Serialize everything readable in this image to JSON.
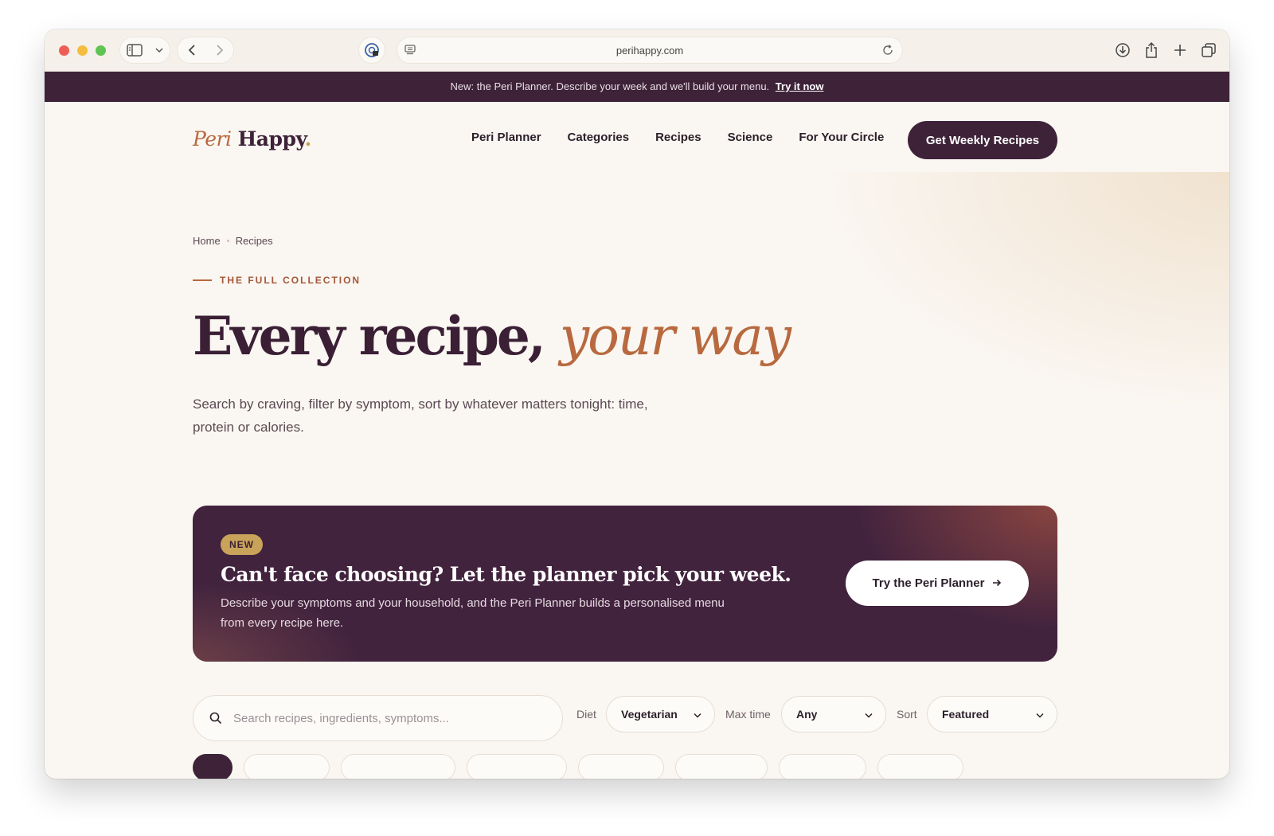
{
  "browser": {
    "url": "perihappy.com"
  },
  "announcement": {
    "text": "New: the Peri Planner. Describe your week and we'll build your menu.",
    "link": "Try it now"
  },
  "logo": {
    "part1": "Peri",
    "part2": "Happy",
    "dot": "."
  },
  "nav": {
    "items": [
      "Peri Planner",
      "Categories",
      "Recipes",
      "Science",
      "For Your Circle"
    ],
    "cta": "Get Weekly Recipes"
  },
  "breadcrumb": [
    "Home",
    "Recipes"
  ],
  "hero": {
    "eyebrow": "THE FULL COLLECTION",
    "title_main": "Every recipe,",
    "title_accent": "your way",
    "subtitle": "Search by craving, filter by symptom, sort by whatever matters tonight: time, protein or calories."
  },
  "banner": {
    "badge": "NEW",
    "title": "Can't face choosing? Let the planner pick your week.",
    "description": "Describe your symptoms and your household, and the Peri Planner builds a personalised menu from every recipe here.",
    "button": "Try the Peri Planner",
    "button_icon": "arrow-right-icon"
  },
  "filters": {
    "search_placeholder": "Search recipes, ingredients, symptoms...",
    "diet_label": "Diet",
    "diet_value": "Vegetarian",
    "time_label": "Max time",
    "time_value": "Any",
    "sort_label": "Sort",
    "sort_value": "Featured"
  },
  "colors": {
    "brand_plum": "#3d2238",
    "accent_copper": "#b8693f",
    "badge_gold": "#c9a35a",
    "background": "#faf6f1"
  }
}
